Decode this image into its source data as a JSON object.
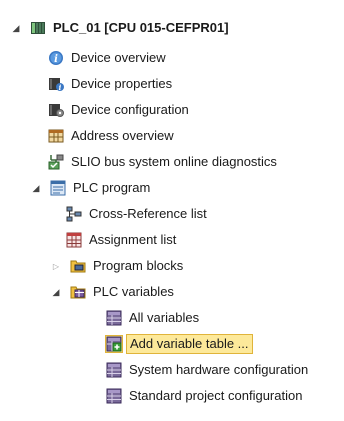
{
  "colors": {
    "selection_bg": "#fde99a",
    "selection_border": "#e0b43a"
  },
  "tree": {
    "root": {
      "label": "PLC_01 [CPU 015-CEFPR01]",
      "icon": "plc-device-icon",
      "expanded": true
    },
    "device_overview": {
      "label": "Device overview",
      "icon": "info-icon"
    },
    "device_properties": {
      "label": "Device properties",
      "icon": "device-properties-icon"
    },
    "device_configuration": {
      "label": "Device configuration",
      "icon": "device-configuration-icon"
    },
    "address_overview": {
      "label": "Address overview",
      "icon": "address-overview-icon"
    },
    "slio_diagnostics": {
      "label": "SLIO bus system online diagnostics",
      "icon": "bus-diagnostics-icon"
    },
    "plc_program": {
      "label": "PLC program",
      "icon": "plc-program-icon",
      "expanded": true
    },
    "cross_reference": {
      "label": "Cross-Reference list",
      "icon": "cross-reference-icon"
    },
    "assignment_list": {
      "label": "Assignment list",
      "icon": "assignment-list-icon"
    },
    "program_blocks": {
      "label": "Program blocks",
      "icon": "folder-blocks-icon",
      "expanded": false
    },
    "plc_variables": {
      "label": "PLC variables",
      "icon": "plc-variables-icon",
      "expanded": true
    },
    "all_variables": {
      "label": "All variables",
      "icon": "variable-table-icon"
    },
    "add_variable_table": {
      "label": "Add variable table ...",
      "icon": "add-table-icon",
      "selected": true
    },
    "system_hw_config": {
      "label": "System hardware configuration",
      "icon": "variable-table-icon"
    },
    "standard_project_config": {
      "label": "Standard project configuration",
      "icon": "variable-table-icon"
    }
  }
}
